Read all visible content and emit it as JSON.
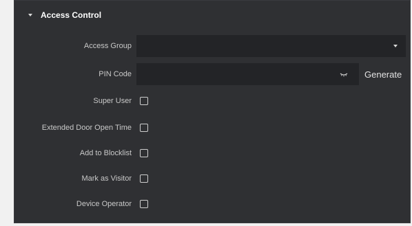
{
  "section": {
    "title": "Access Control"
  },
  "fields": {
    "access_group": {
      "label": "Access Group",
      "value": ""
    },
    "pin_code": {
      "label": "PIN Code",
      "value": "",
      "action_label": "Generate"
    }
  },
  "checkboxes": [
    {
      "label": "Super User",
      "checked": false
    },
    {
      "label": "Extended Door Open Time",
      "checked": false
    },
    {
      "label": "Add to Blocklist",
      "checked": false
    },
    {
      "label": "Mark as Visitor",
      "checked": false
    },
    {
      "label": "Device Operator",
      "checked": false
    }
  ],
  "colors": {
    "panel_background": "#2f3033",
    "input_background": "#232427",
    "label_text": "#c9c9c9",
    "header_text": "#ffffff"
  }
}
